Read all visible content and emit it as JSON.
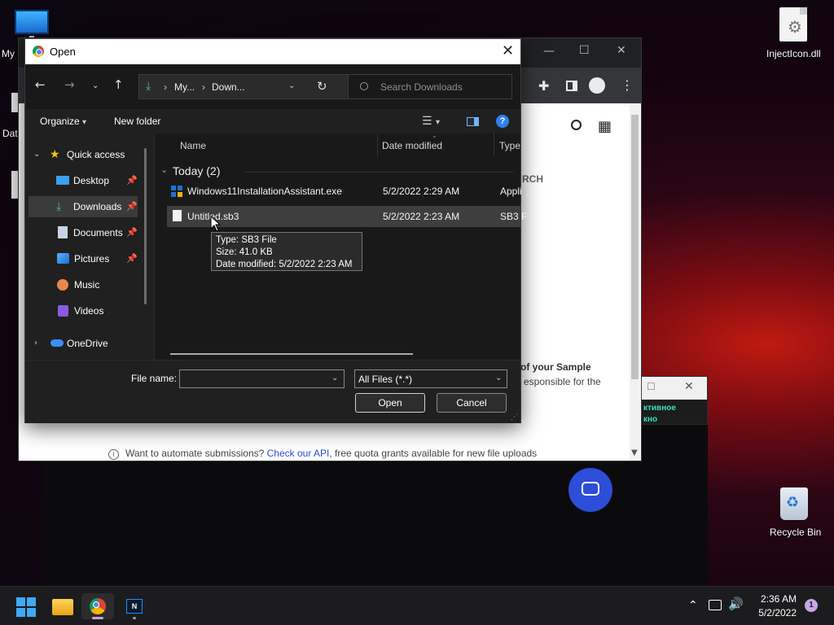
{
  "desktop": {
    "icons": [
      {
        "label": "My"
      },
      {
        "label": "Dat"
      },
      {
        "label": "InjectIcon.dll"
      },
      {
        "label": "Recycle Bin"
      }
    ]
  },
  "browser": {
    "footer_info": "Want to automate submissions? ",
    "footer_link": "Check our API",
    "footer_rest": ", free quota grants available for new file uploads",
    "partial_heading": "RCH",
    "partial_sample": "of your Sample",
    "partial_responsible": "esponsible for the"
  },
  "mini_window": {
    "line1": "ктивное",
    "line2": "кно"
  },
  "dialog": {
    "title": "Open",
    "address": {
      "seg1": "My...",
      "seg2": "Down..."
    },
    "search_placeholder": "Search Downloads",
    "commands": {
      "organize": "Organize",
      "new_folder": "New folder"
    },
    "nav": [
      {
        "label": "Quick access"
      },
      {
        "label": "Desktop"
      },
      {
        "label": "Downloads"
      },
      {
        "label": "Documents"
      },
      {
        "label": "Pictures"
      },
      {
        "label": "Music"
      },
      {
        "label": "Videos"
      },
      {
        "label": "OneDrive"
      }
    ],
    "columns": {
      "name": "Name",
      "date": "Date modified",
      "type": "Type"
    },
    "group": "Today (2)",
    "files": [
      {
        "name": "Windows11InstallationAssistant.exe",
        "date": "5/2/2022 2:29 AM",
        "type": "Appli"
      },
      {
        "name": "Untitled.sb3",
        "date": "5/2/2022 2:23 AM",
        "type": "SB3 F"
      }
    ],
    "tooltip": {
      "type": "Type: SB3 File",
      "size": "Size: 41.0 KB",
      "date": "Date modified: 5/2/2022 2:23 AM"
    },
    "file_name_label": "File name:",
    "file_name_value": "",
    "file_type": "All Files (*.*)",
    "open_btn": "Open",
    "cancel_btn": "Cancel"
  },
  "taskbar": {
    "time": "2:36 AM",
    "date": "5/2/2022",
    "notifications": "1"
  }
}
